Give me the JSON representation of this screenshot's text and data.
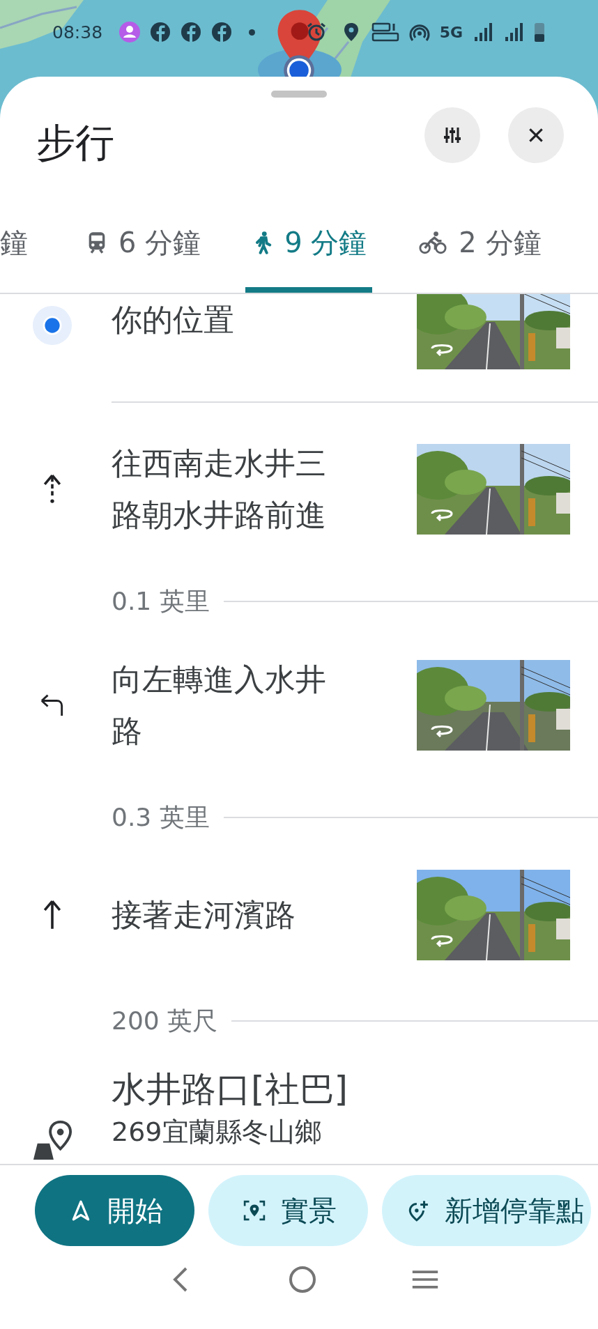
{
  "status_bar": {
    "time": "08:38",
    "network": "5G"
  },
  "title": "步行",
  "modes": [
    {
      "kind": "partial",
      "label": "鐘",
      "selected": false
    },
    {
      "kind": "transit",
      "label": "6 分鐘",
      "selected": false
    },
    {
      "kind": "walk",
      "label": "9 分鐘",
      "selected": true
    },
    {
      "kind": "bike",
      "label": "2 分鐘",
      "selected": false
    }
  ],
  "items": [
    {
      "kind": "origin",
      "lines": [
        "你的位置"
      ]
    },
    {
      "kind": "head",
      "lines": [
        "往西南走水井三",
        "路朝水井路前進"
      ]
    },
    {
      "kind": "distance",
      "text": "0.1 英里"
    },
    {
      "kind": "left",
      "lines": [
        "向左轉進入水井",
        "路"
      ]
    },
    {
      "kind": "distance",
      "text": "0.3 英里"
    },
    {
      "kind": "straight",
      "lines": [
        "接著走河濱路"
      ]
    },
    {
      "kind": "distance",
      "text": "200 英尺"
    },
    {
      "kind": "stop",
      "title": "水井路口[社巴]",
      "address": "269宜蘭縣冬山鄉"
    }
  ],
  "actions": [
    {
      "kind": "start",
      "label": "開始"
    },
    {
      "kind": "live",
      "label": "實景"
    },
    {
      "kind": "add_stop",
      "label": "新增停靠點"
    }
  ]
}
